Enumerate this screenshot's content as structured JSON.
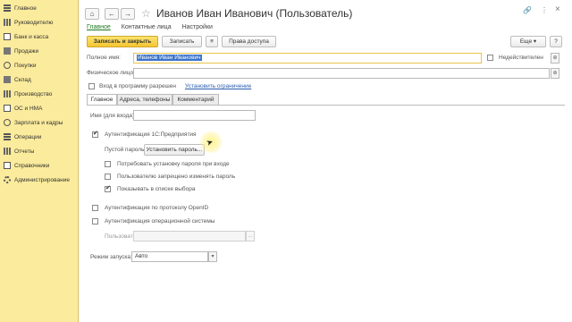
{
  "sidebar": {
    "items": [
      {
        "label": "Главное",
        "icon": "stack-icon"
      },
      {
        "label": "Руководителю",
        "icon": "chart-icon"
      },
      {
        "label": "Банк и касса",
        "icon": "bank-icon"
      },
      {
        "label": "Продажи",
        "icon": "sales-icon"
      },
      {
        "label": "Покупки",
        "icon": "cart-icon"
      },
      {
        "label": "Склад",
        "icon": "warehouse-icon"
      },
      {
        "label": "Производство",
        "icon": "factory-icon"
      },
      {
        "label": "ОС и НМА",
        "icon": "assets-icon"
      },
      {
        "label": "Зарплата и кадры",
        "icon": "people-icon"
      },
      {
        "label": "Операции",
        "icon": "operations-icon"
      },
      {
        "label": "Отчеты",
        "icon": "reports-icon"
      },
      {
        "label": "Справочники",
        "icon": "book-icon"
      },
      {
        "label": "Администрирование",
        "icon": "gear-icon"
      }
    ]
  },
  "window": {
    "title": "Иванов Иван Иванович (Пользователь)",
    "back": "←",
    "forward": "→",
    "star": "☆",
    "link_icon": "🔗",
    "menu_icon": "⋮",
    "close_icon": "×"
  },
  "nav_tabs": [
    "Главное",
    "Контактные лица",
    "Настройки"
  ],
  "toolbar": {
    "save_close": "Записать и закрыть",
    "save": "Записать",
    "list_icon": "≡",
    "access": "Права доступа",
    "more": "Еще",
    "more_arrow": "▾",
    "help": "?"
  },
  "form": {
    "full_name_label": "Полное имя:",
    "full_name_value": "Иванов Иван Иванович",
    "inactive_label": "Недействителен",
    "person_label": "Физическое лицо:",
    "login_allowed_label": "Вход в программу разрешен",
    "set_limit_link": "Установить ограничение",
    "dots": "...",
    "open": "⊕"
  },
  "inner_tabs": [
    "Главное",
    "Адреса, телефоны",
    "Комментарий"
  ],
  "auth": {
    "login_name_label": "Имя (для входа):",
    "login_name_value": "",
    "enterprise_auth": "Аутентификация 1С:Предприятия",
    "empty_password": "Пустой пароль",
    "set_password_btn": "Установить пароль...",
    "require_password_change": "Потребовать установку пароля при входе",
    "forbid_password_change": "Пользователю запрещено изменять пароль",
    "show_in_list": "Показывать в списке выбора",
    "openid_auth": "Аутентификация по протоколу OpenID",
    "os_auth": "Аутентификация операционной системы",
    "user_label": "Пользователь:",
    "launch_mode_label": "Режим запуска:",
    "launch_mode_value": "Авто",
    "dropdown_arrow": "▾"
  }
}
